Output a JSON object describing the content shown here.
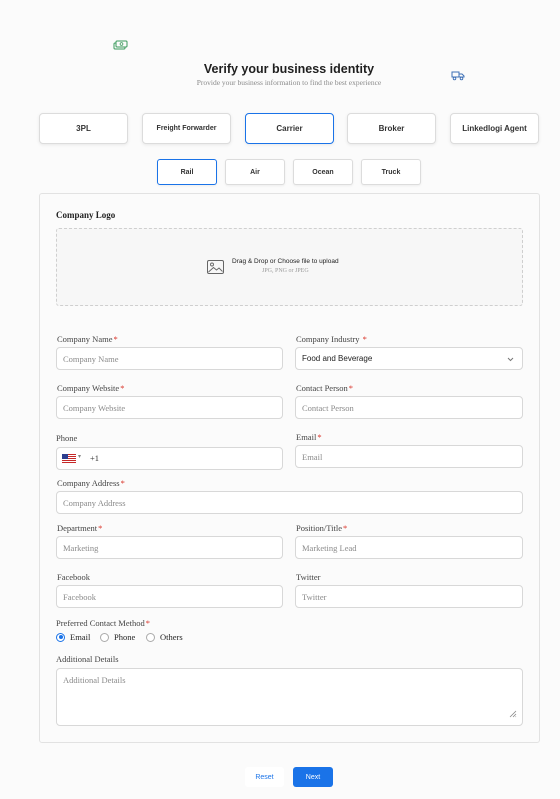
{
  "header": {
    "title": "Verify your business identity",
    "subtitle": "Provide your business information to find the best experience"
  },
  "decorations": [
    {
      "icon": "money-icon",
      "color": "#3a9a5b"
    },
    {
      "icon": "truck-icon",
      "color": "#3d6fb6"
    }
  ],
  "business_types": [
    {
      "label": "3PL",
      "selected": false
    },
    {
      "label": "Freight Forwarder",
      "selected": false
    },
    {
      "label": "Carrier",
      "selected": true
    },
    {
      "label": "Broker",
      "selected": false
    },
    {
      "label": "Linkedlogi Agent",
      "selected": false
    }
  ],
  "transport_modes": [
    {
      "label": "Rail",
      "selected": true
    },
    {
      "label": "Air",
      "selected": false
    },
    {
      "label": "Ocean",
      "selected": false
    },
    {
      "label": "Truck",
      "selected": false
    }
  ],
  "logo": {
    "label": "Company Logo",
    "upload_text": "Drag & Drop or Choose file to upload",
    "formats": "JPG, PNG or JPEG",
    "icon": "image-icon"
  },
  "fields": {
    "company_name": {
      "label": "Company Name",
      "required": "*",
      "placeholder": "Company Name"
    },
    "company_industry": {
      "label": "Company Industry",
      "required": "*",
      "value": "Food and Beverage"
    },
    "company_website": {
      "label": "Company Website",
      "required": "*",
      "placeholder": "Company Website"
    },
    "contact_person": {
      "label": "Contact Person",
      "required": "*",
      "placeholder": "Contact Person"
    },
    "phone": {
      "label": "Phone",
      "country": "US",
      "code": "+1"
    },
    "email": {
      "label": "Email",
      "required": "*",
      "placeholder": "Email"
    },
    "company_address": {
      "label": "Company Address",
      "required": "*",
      "placeholder": "Company Address"
    },
    "department": {
      "label": "Department",
      "required": "*",
      "placeholder": "Marketing"
    },
    "position": {
      "label": "Position/Title",
      "required": "*",
      "placeholder": "Marketing Lead"
    },
    "facebook": {
      "label": "Facebook",
      "placeholder": "Facebook"
    },
    "twitter": {
      "label": "Twitter",
      "placeholder": "Twitter"
    },
    "contact_method": {
      "label": "Preferred Contact Method",
      "required": "*",
      "options": [
        {
          "label": "Email",
          "selected": true
        },
        {
          "label": "Phone",
          "selected": false
        },
        {
          "label": "Others",
          "selected": false
        }
      ]
    },
    "additional": {
      "label": "Additional Details",
      "placeholder": "Additional Details"
    }
  },
  "actions": {
    "reset_label": "Reset",
    "next_label": "Next"
  },
  "colors": {
    "accent": "#1a73e8",
    "required": "#d93025"
  }
}
